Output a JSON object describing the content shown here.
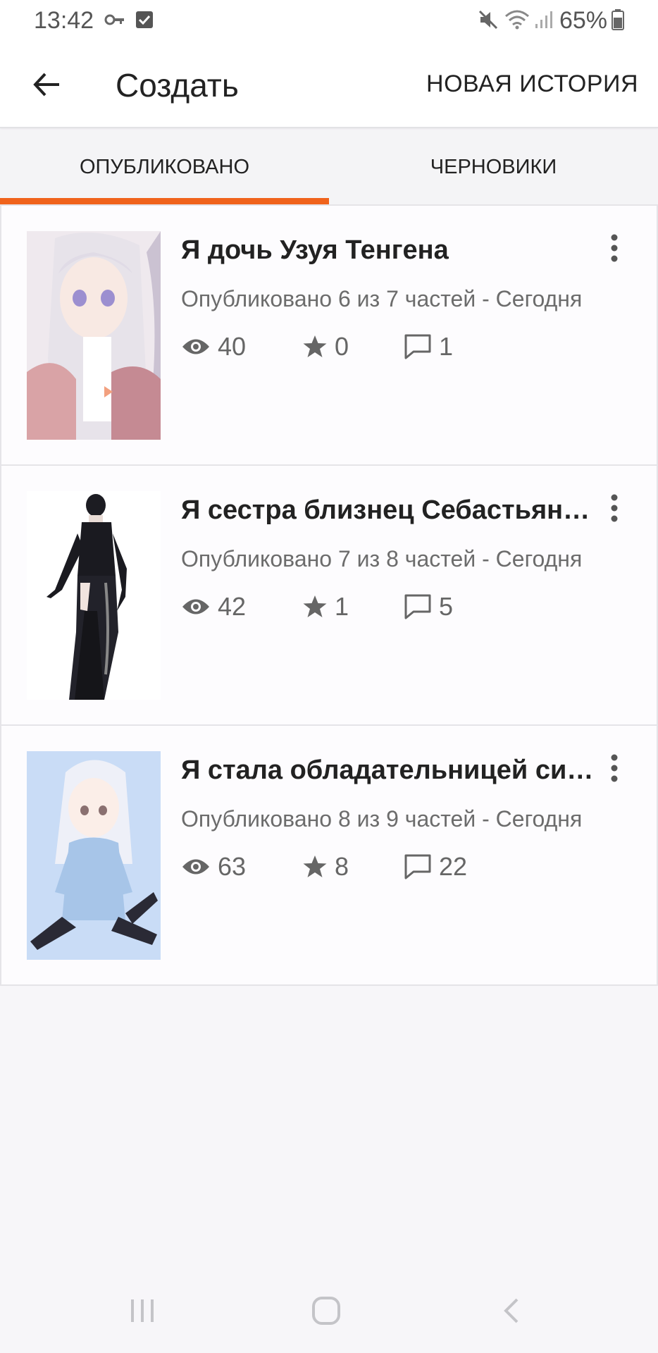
{
  "status_bar": {
    "time": "13:42",
    "battery": "65%",
    "icons": [
      "key-icon",
      "check-square-icon",
      "mute-icon",
      "wifi-icon",
      "signal-icon",
      "battery-icon"
    ]
  },
  "app_bar": {
    "title": "Создать",
    "new_story_label": "НОВАЯ ИСТОРИЯ"
  },
  "tabs": [
    {
      "label": "ОПУБЛИКОВАНО",
      "active": true
    },
    {
      "label": "ЧЕРНОВИКИ",
      "active": false
    }
  ],
  "accent_color": "#f0631c",
  "stories": [
    {
      "title": "Я дочь Узуя Тенгена",
      "meta": "Опубликовано 6 из 7 частей - Сегодня",
      "views": "40",
      "votes": "0",
      "comments": "1"
    },
    {
      "title": "Я сестра близнец Себастьяна…",
      "meta": "Опубликовано 7 из 8 частей - Сегодня",
      "views": "42",
      "votes": "1",
      "comments": "5"
    },
    {
      "title": "Я стала обладательницей сис…",
      "meta": "Опубликовано 8 из 9 частей - Сегодня",
      "views": "63",
      "votes": "8",
      "comments": "22"
    }
  ]
}
